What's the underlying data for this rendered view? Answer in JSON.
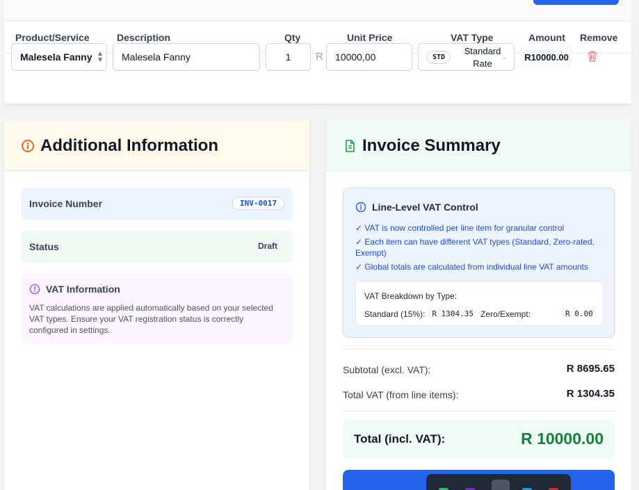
{
  "colors": {
    "primary_blue": "#2563eb",
    "total_green": "#15803d",
    "remove_red": "#f87171",
    "info_orange": "#ea580c",
    "summary_green": "#16a34a",
    "vat_purple": "#a855f7"
  },
  "line_items": {
    "headers": {
      "product": "Product/Service",
      "description": "Description",
      "qty": "Qty",
      "unit_price": "Unit Price",
      "vat_type": "VAT Type",
      "amount": "Amount",
      "remove": "Remove"
    },
    "row": {
      "product": "Malesela Fanny",
      "description": "Malesela Fanny",
      "qty": "1",
      "currency_symbol": "R",
      "unit_price": "10000,00",
      "vat_badge": "STD",
      "vat_label": "Standard Rate",
      "amount": "R10000.00",
      "remove_icon": "trash-icon"
    }
  },
  "additional_info": {
    "title": "Additional Information",
    "icon": "info-circle-icon",
    "invoice_number_label": "Invoice Number",
    "invoice_number": "INV-0017",
    "status_label": "Status",
    "status": "Draft",
    "vat_info_title": "VAT Information",
    "vat_info_text": "VAT calculations are applied automatically based on your selected VAT types. Ensure your VAT registration status is correctly configured in settings."
  },
  "summary": {
    "title": "Invoice Summary",
    "icon": "document-icon",
    "vat_control_title": "Line-Level VAT Control",
    "vat_control_points": [
      "✓ VAT is now controlled per line item for granular control",
      "✓ Each item can have different VAT types (Standard, Zero-rated, Exempt)",
      "✓ Global totals are calculated from individual line VAT amounts"
    ],
    "breakdown_title": "VAT Breakdown by Type:",
    "standard_label": "Standard (15%):",
    "standard_value": "R 1304.35",
    "zero_label": "Zero/Exempt:",
    "zero_value": "R 0.00",
    "subtotal_label": "Subtotal (excl. VAT):",
    "subtotal_value": "R 8695.65",
    "total_vat_label": "Total VAT (from line items):",
    "total_vat_value": "R 1304.35",
    "total_label": "Total (incl. VAT):",
    "total_value": "R 10000.00"
  }
}
